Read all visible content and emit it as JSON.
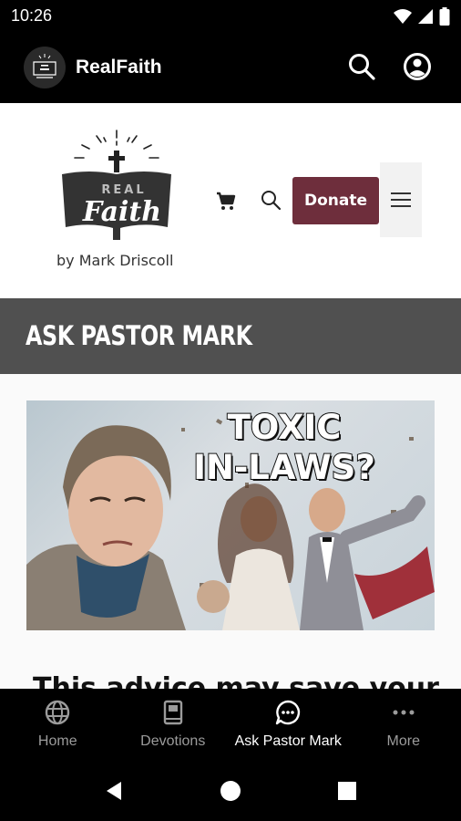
{
  "status_bar": {
    "time": "10:26",
    "icons": [
      "wifi-icon",
      "signal-icon",
      "battery-icon"
    ]
  },
  "app_bar": {
    "title": "RealFaith",
    "logo_icon": "realfaith-logo-icon",
    "actions": [
      "search-icon",
      "account-icon"
    ]
  },
  "site_header": {
    "logo": {
      "word1": "REAL",
      "word2": "Faith",
      "byline": "by Mark Driscoll"
    },
    "donate_label": "Donate",
    "icons": [
      "cart-icon",
      "search-icon",
      "hamburger-menu-icon"
    ]
  },
  "page": {
    "banner_title": "ASK PASTOR MARK",
    "hero_caption_line1": "TOXIC",
    "hero_caption_line2": "IN-LAWS?",
    "article_title_partial": "This advice may save your"
  },
  "bottom_nav": {
    "tabs": [
      {
        "label": "Home",
        "icon": "globe-icon",
        "active": false
      },
      {
        "label": "Devotions",
        "icon": "book-icon",
        "active": false
      },
      {
        "label": "Ask Pastor Mark",
        "icon": "chat-bubble-icon",
        "active": true
      },
      {
        "label": "More",
        "icon": "more-dots-icon",
        "active": false
      }
    ]
  },
  "system_nav": [
    "back-icon",
    "home-icon",
    "recents-icon"
  ],
  "colors": {
    "donate": "#6e2e3c",
    "banner": "#505050",
    "bar": "#000000",
    "inactive_tab": "#9b9b9b"
  }
}
